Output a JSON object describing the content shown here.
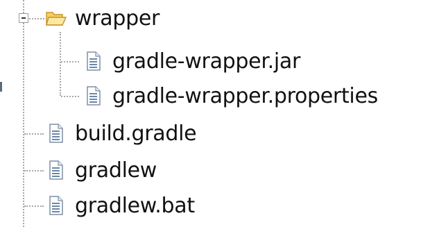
{
  "tree": {
    "folder": {
      "label": "wrapper",
      "icon": "open-folder-icon",
      "expanded": true,
      "children": [
        {
          "label": "gradle-wrapper.jar",
          "icon": "text-file-icon"
        },
        {
          "label": "gradle-wrapper.properties",
          "icon": "text-file-icon"
        }
      ]
    },
    "files": [
      {
        "label": "build.gradle",
        "icon": "text-file-icon"
      },
      {
        "label": "gradlew",
        "icon": "text-file-icon"
      },
      {
        "label": "gradlew.bat",
        "icon": "text-file-icon"
      }
    ],
    "colors": {
      "folder_fill": "#f7d978",
      "folder_stroke": "#c7932a",
      "file_stroke": "#7b8fa6",
      "file_lines": "#6b86a8",
      "connector": "#a6a6a6"
    }
  }
}
